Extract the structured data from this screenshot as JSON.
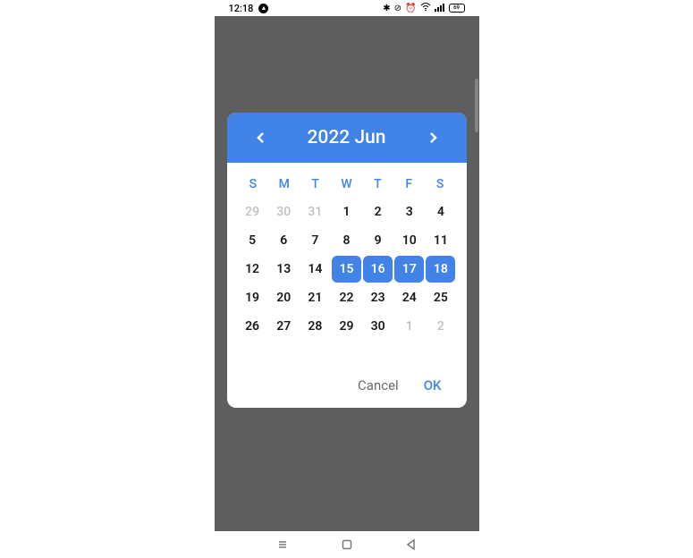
{
  "status_bar": {
    "time": "12:18",
    "battery_text": "69",
    "icons": [
      "bluetooth",
      "dnd",
      "alarm",
      "wifi",
      "signal",
      "battery"
    ]
  },
  "calendar": {
    "header_title": "2022 Jun",
    "weekdays": [
      "S",
      "M",
      "T",
      "W",
      "T",
      "F",
      "S"
    ],
    "days": [
      {
        "d": "29",
        "other": true,
        "sel": false
      },
      {
        "d": "30",
        "other": true,
        "sel": false
      },
      {
        "d": "31",
        "other": true,
        "sel": false
      },
      {
        "d": "1",
        "other": false,
        "sel": false
      },
      {
        "d": "2",
        "other": false,
        "sel": false
      },
      {
        "d": "3",
        "other": false,
        "sel": false
      },
      {
        "d": "4",
        "other": false,
        "sel": false
      },
      {
        "d": "5",
        "other": false,
        "sel": false
      },
      {
        "d": "6",
        "other": false,
        "sel": false
      },
      {
        "d": "7",
        "other": false,
        "sel": false
      },
      {
        "d": "8",
        "other": false,
        "sel": false
      },
      {
        "d": "9",
        "other": false,
        "sel": false
      },
      {
        "d": "10",
        "other": false,
        "sel": false
      },
      {
        "d": "11",
        "other": false,
        "sel": false
      },
      {
        "d": "12",
        "other": false,
        "sel": false
      },
      {
        "d": "13",
        "other": false,
        "sel": false
      },
      {
        "d": "14",
        "other": false,
        "sel": false
      },
      {
        "d": "15",
        "other": false,
        "sel": true
      },
      {
        "d": "16",
        "other": false,
        "sel": true
      },
      {
        "d": "17",
        "other": false,
        "sel": true
      },
      {
        "d": "18",
        "other": false,
        "sel": true
      },
      {
        "d": "19",
        "other": false,
        "sel": false
      },
      {
        "d": "20",
        "other": false,
        "sel": false
      },
      {
        "d": "21",
        "other": false,
        "sel": false
      },
      {
        "d": "22",
        "other": false,
        "sel": false
      },
      {
        "d": "23",
        "other": false,
        "sel": false
      },
      {
        "d": "24",
        "other": false,
        "sel": false
      },
      {
        "d": "25",
        "other": false,
        "sel": false
      },
      {
        "d": "26",
        "other": false,
        "sel": false
      },
      {
        "d": "27",
        "other": false,
        "sel": false
      },
      {
        "d": "28",
        "other": false,
        "sel": false
      },
      {
        "d": "29",
        "other": false,
        "sel": false
      },
      {
        "d": "30",
        "other": false,
        "sel": false
      },
      {
        "d": "1",
        "other": true,
        "sel": false
      },
      {
        "d": "2",
        "other": true,
        "sel": false
      }
    ],
    "actions": {
      "cancel": "Cancel",
      "ok": "OK"
    }
  },
  "colors": {
    "primary": "#4183e6",
    "muted": "#bfbfbf"
  }
}
